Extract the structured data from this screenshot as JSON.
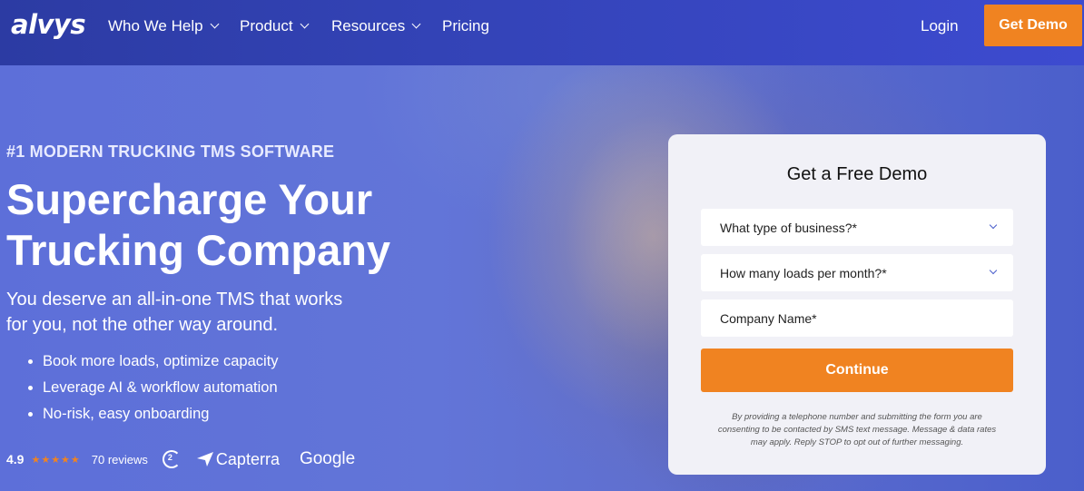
{
  "nav": {
    "logo": "alvys",
    "items": [
      {
        "label": "Who We Help",
        "has_dropdown": true
      },
      {
        "label": "Product",
        "has_dropdown": true
      },
      {
        "label": "Resources",
        "has_dropdown": true
      },
      {
        "label": "Pricing",
        "has_dropdown": false
      }
    ],
    "login": "Login",
    "cta": "Get Demo"
  },
  "hero": {
    "eyebrow": "#1 MODERN TRUCKING TMS SOFTWARE",
    "headline_line1": "Supercharge Your",
    "headline_line2": "Trucking Company",
    "subhead_line1": "You deserve an all-in-one TMS that works",
    "subhead_line2": "for you, not the other way around.",
    "bullets": [
      "Book more loads, optimize capacity",
      "Leverage AI & workflow automation",
      "No-risk, easy onboarding"
    ],
    "rating": {
      "score": "4.9",
      "stars": "★★★★★",
      "reviews": "70 reviews",
      "badges": [
        "G2",
        "Capterra",
        "Google"
      ]
    }
  },
  "form": {
    "title": "Get a Free Demo",
    "business_type_placeholder": "What type of business?*",
    "loads_placeholder": "How many loads per month?*",
    "company_placeholder": "Company Name*",
    "submit": "Continue",
    "disclaimer_line1": "By providing a telephone number and submitting the form you are",
    "disclaimer_line2": "consenting to be contacted by SMS text message. Message & data rates",
    "disclaimer_line3": "may apply. Reply STOP to opt out of further messaging."
  },
  "colors": {
    "accent": "#f08321",
    "nav_bg": "#3343b6",
    "hero_bg": "#5d6fd9"
  }
}
